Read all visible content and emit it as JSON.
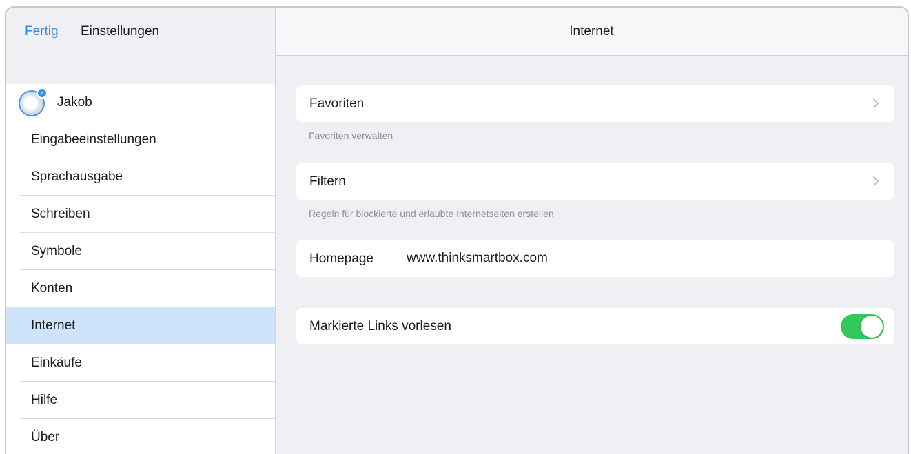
{
  "sidebar": {
    "done_label": "Fertig",
    "title": "Einstellungen",
    "user": {
      "name": "Jakob"
    },
    "items": [
      {
        "label": "Eingabeeinstellungen"
      },
      {
        "label": "Sprachausgabe"
      },
      {
        "label": "Schreiben"
      },
      {
        "label": "Symbole"
      },
      {
        "label": "Konten"
      },
      {
        "label": "Internet",
        "selected": true
      },
      {
        "label": "Einkäufe"
      },
      {
        "label": "Hilfe"
      },
      {
        "label": "Über"
      }
    ]
  },
  "main": {
    "title": "Internet",
    "favorites": {
      "label": "Favoriten",
      "note": "Favoriten verwalten",
      "icon": "chevron-right-icon"
    },
    "filter": {
      "label": "Filtern",
      "note": "Regeln für blockierte und erlaubte Internetseiten erstellen",
      "icon": "chevron-right-icon"
    },
    "homepage": {
      "label": "Homepage",
      "value": "www.thinksmartbox.com"
    },
    "read_links": {
      "label": "Markierte Links vorlesen",
      "enabled": true
    }
  },
  "colors": {
    "accent": "#2e8bf0",
    "selected_row": "#cfe4fa",
    "toggle_on": "#34c759",
    "background": "#efeff4"
  }
}
